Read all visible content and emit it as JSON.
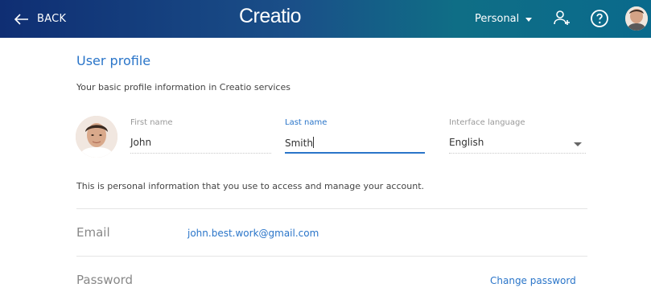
{
  "header": {
    "back_label": "BACK",
    "logo_text": "Creatio",
    "persona_label": "Personal",
    "accent_gradient": [
      "#0f2e73",
      "#0a6a8c"
    ]
  },
  "profile": {
    "title": "User profile",
    "subtitle": "Your basic profile information in Creatio services",
    "first_name": {
      "label": "First name",
      "value": "John"
    },
    "last_name": {
      "label": "Last name",
      "value": "Smith"
    },
    "language": {
      "label": "Interface language",
      "value": "English"
    },
    "note": "This is personal information that you use to access and manage your account."
  },
  "email": {
    "label": "Email",
    "value": "john.best.work@gmail.com"
  },
  "password": {
    "label": "Password",
    "action": "Change password"
  },
  "icons": [
    "back-arrow-icon",
    "user-add-icon",
    "help-icon",
    "chevron-down-icon"
  ],
  "colors": {
    "link": "#2a75c9",
    "muted": "#888888"
  }
}
